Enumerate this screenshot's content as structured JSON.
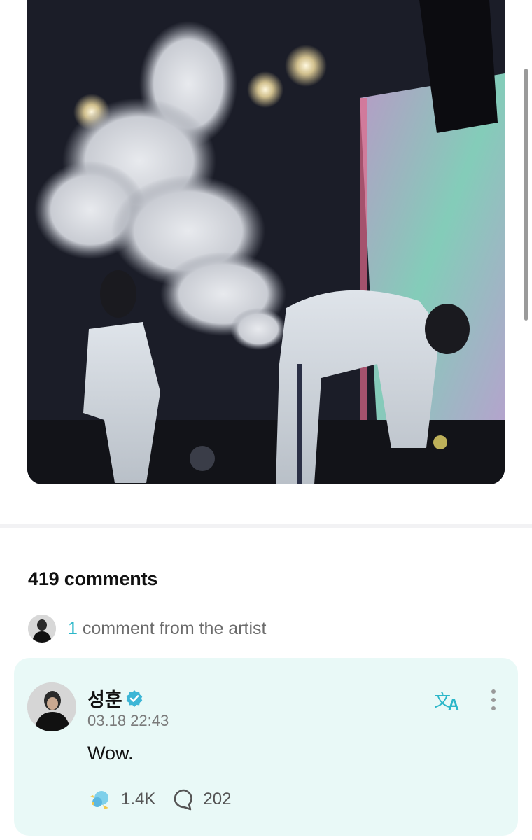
{
  "post": {
    "media_description": "concert-photo"
  },
  "comments": {
    "count_label": "419 comments"
  },
  "artist_comments": {
    "count": "1",
    "label": "comment from the artist"
  },
  "featured_comment": {
    "author": "성훈",
    "timestamp": "03.18 22:43",
    "text": "Wow.",
    "likes": "1.4K",
    "replies": "202"
  },
  "colors": {
    "accent": "#2bb7c9",
    "card_bg": "#e9f9f7",
    "verified": "#3db6d6"
  },
  "icons": [
    "verified-badge-icon",
    "translate-icon",
    "more-options-icon",
    "cheer-icon",
    "reply-icon"
  ]
}
